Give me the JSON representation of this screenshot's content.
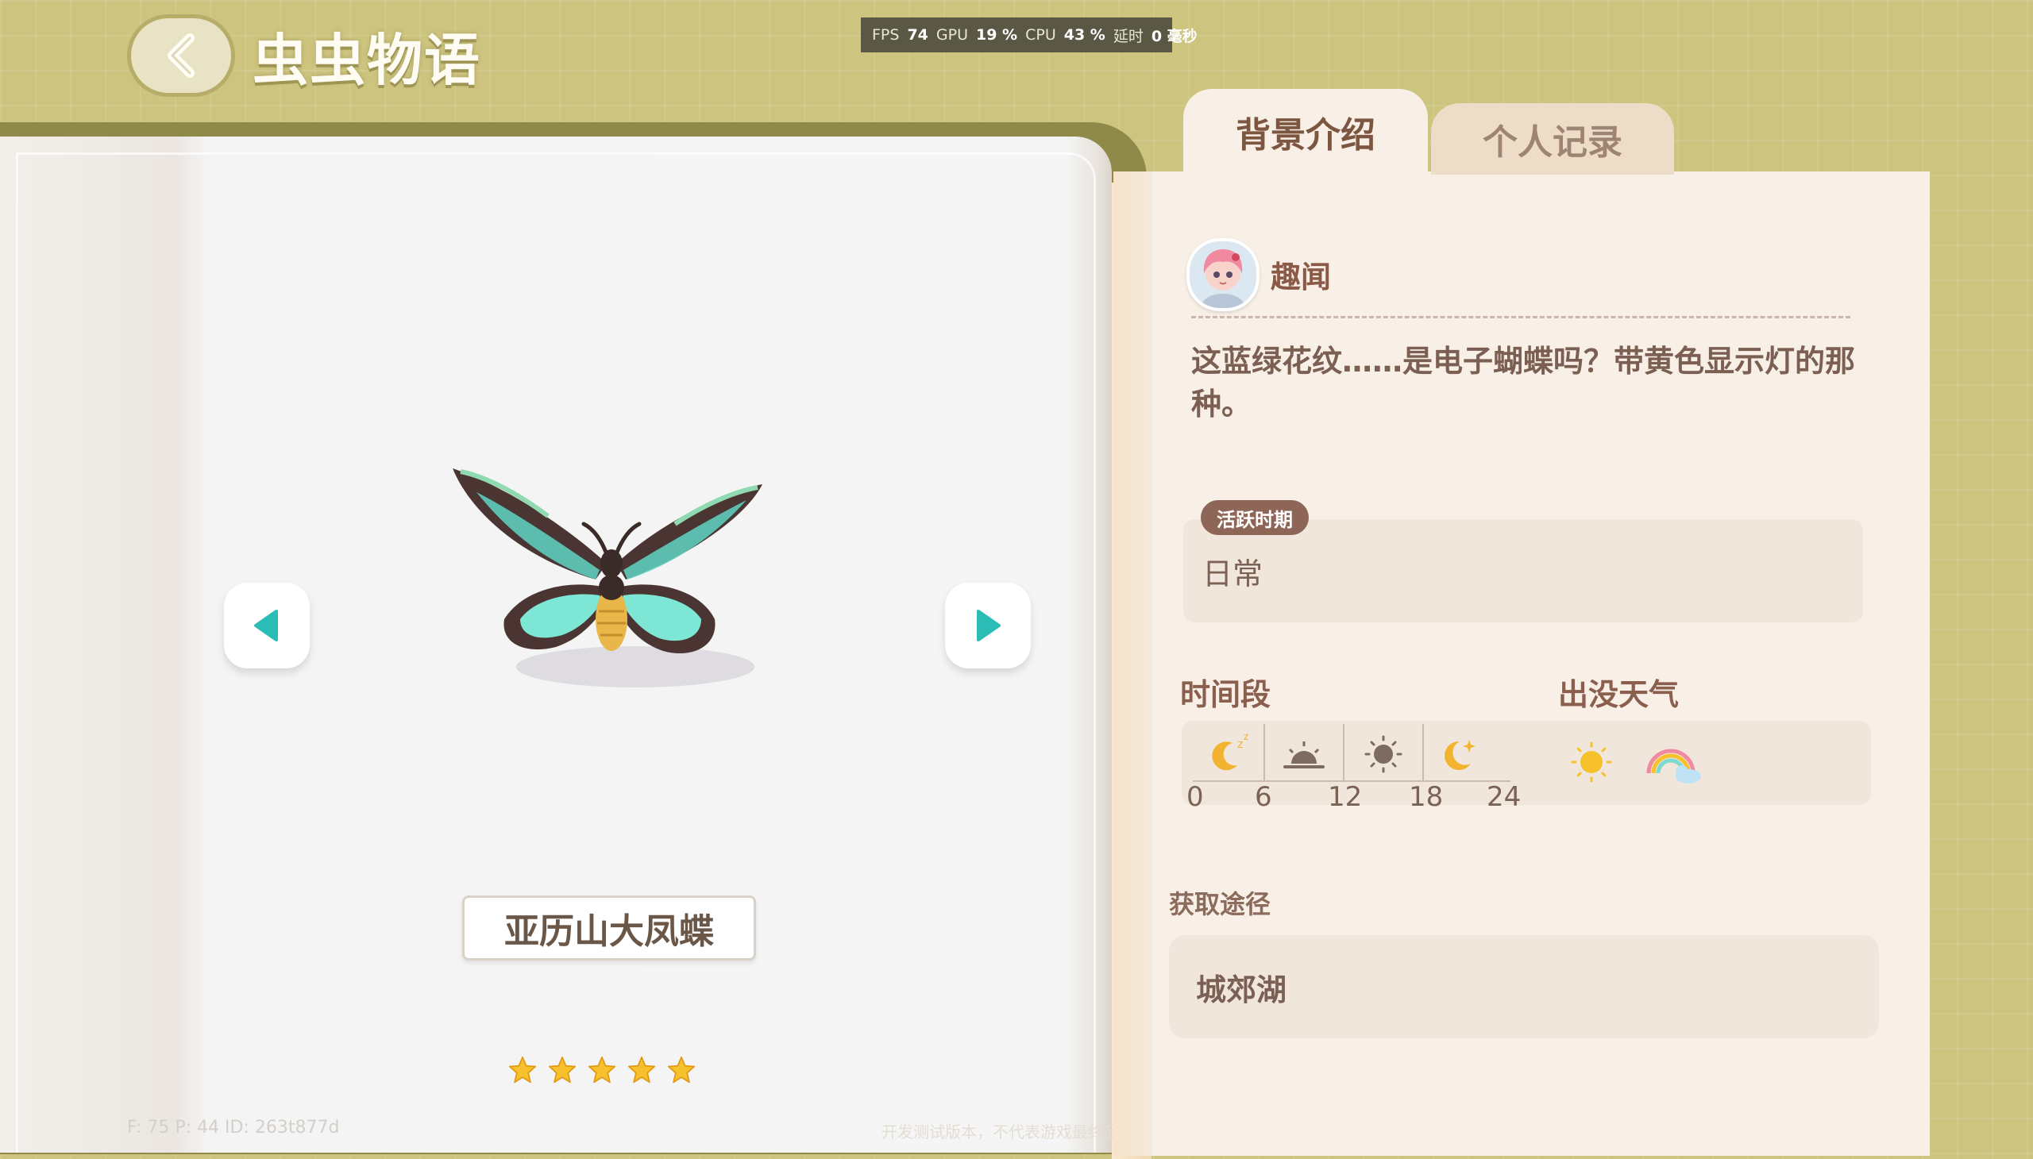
{
  "header": {
    "title": "虫虫物语"
  },
  "perf": {
    "fps_label": "FPS",
    "fps": "74",
    "gpu_label": "GPU",
    "gpu": "19 %",
    "cpu_label": "CPU",
    "cpu": "43 %",
    "delay_label": "延时",
    "delay": "0 毫秒"
  },
  "insect": {
    "name": "亚历山大凤蝶",
    "rating_stars": 5
  },
  "debug": {
    "left": "F: 75     P: 44     ID: 263t877d",
    "right": "开发测试版本，不代表游戏最终品质"
  },
  "tabs": [
    {
      "label": "背景介绍",
      "active": true
    },
    {
      "label": "个人记录",
      "active": false
    }
  ],
  "fun_fact": {
    "title": "趣闻",
    "text": "这蓝绿花纹……是电子蝴蝶吗？带黄色显示灯的那种。"
  },
  "active_period": {
    "tag": "活跃时期",
    "value": "日常"
  },
  "time_section": {
    "label": "时间段",
    "ticks": [
      "0",
      "6",
      "12",
      "18",
      "24"
    ],
    "icons": [
      "moon-sleep-icon",
      "sunrise-icon",
      "sun-icon",
      "moon-icon"
    ]
  },
  "weather_section": {
    "label": "出没天气",
    "icons": [
      "sunny-icon",
      "rainbow-icon"
    ]
  },
  "acquisition": {
    "label": "获取途径",
    "value": "城郊湖"
  },
  "colors": {
    "background": "#cdc47f",
    "panel": "#f8efe6",
    "accent_teal": "#2bbcb5",
    "text_brown": "#8b5f4e"
  }
}
